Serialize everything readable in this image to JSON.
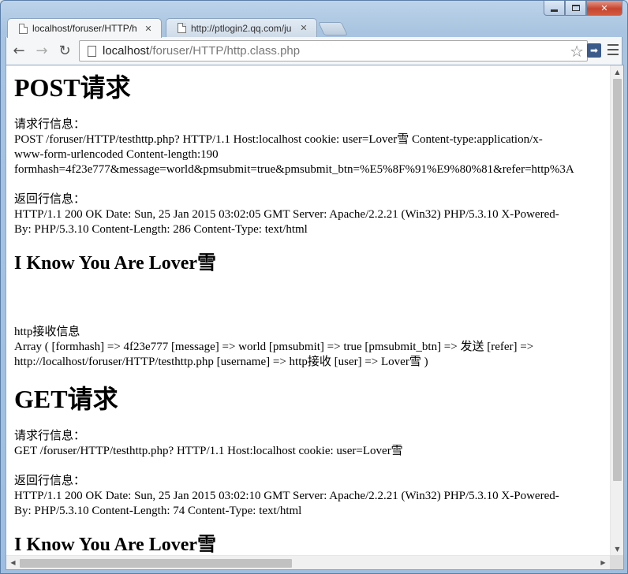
{
  "window": {
    "controls": {
      "minimize": "minimize",
      "maximize": "maximize",
      "close": "✕"
    }
  },
  "tabs": [
    {
      "title": "localhost/foruser/HTTP/h",
      "active": true,
      "close": "✕"
    },
    {
      "title": "http://ptlogin2.qq.com/ju",
      "active": false,
      "close": "✕"
    }
  ],
  "toolbar": {
    "back": "←",
    "forward": "→",
    "reload": "↻",
    "url_host": "localhost",
    "url_path": "/foruser/HTTP/http.class.php",
    "star": "☆",
    "extension": "➡"
  },
  "page": {
    "post_heading": "POST请求",
    "post_request_label": "请求行信息：",
    "post_request_line1": "POST /foruser/HTTP/testhttp.php? HTTP/1.1 Host:localhost cookie: user=Lover雪 Content-type:application/x-",
    "post_request_line2": "www-form-urlencoded Content-length:190",
    "post_request_line3": "formhash=4f23e777&message=world&pmsubmit=true&pmsubmit_btn=%E5%8F%91%E9%80%81&refer=http%3A",
    "post_response_label": "返回行信息：",
    "post_response_line1": "HTTP/1.1 200 OK Date: Sun, 25 Jan 2015 03:02:05 GMT Server: Apache/2.2.21 (Win32) PHP/5.3.10 X-Powered-",
    "post_response_line2": "By: PHP/5.3.10 Content-Length: 286 Content-Type: text/html",
    "post_lover_heading": "I Know You Are Lover雪",
    "recv_label": "http接收信息",
    "recv_line1": "Array ( [formhash] => 4f23e777 [message] => world [pmsubmit] => true [pmsubmit_btn] => 发送 [refer] =>",
    "recv_line2": "http://localhost/foruser/HTTP/testhttp.php [username] => http接收 [user] => Lover雪 )",
    "get_heading": "GET请求",
    "get_request_label": "请求行信息：",
    "get_request_line1": "GET /foruser/HTTP/testhttp.php? HTTP/1.1 Host:localhost cookie: user=Lover雪",
    "get_response_label": "返回行信息：",
    "get_response_line1": "HTTP/1.1 200 OK Date: Sun, 25 Jan 2015 03:02:10 GMT Server: Apache/2.2.21 (Win32) PHP/5.3.10 X-Powered-",
    "get_response_line2": "By: PHP/5.3.10 Content-Length: 74 Content-Type: text/html",
    "get_lover_heading": "I Know You Are Lover雪"
  },
  "scroll": {
    "up": "▲",
    "down": "▼",
    "left": "◀",
    "right": "▶"
  }
}
